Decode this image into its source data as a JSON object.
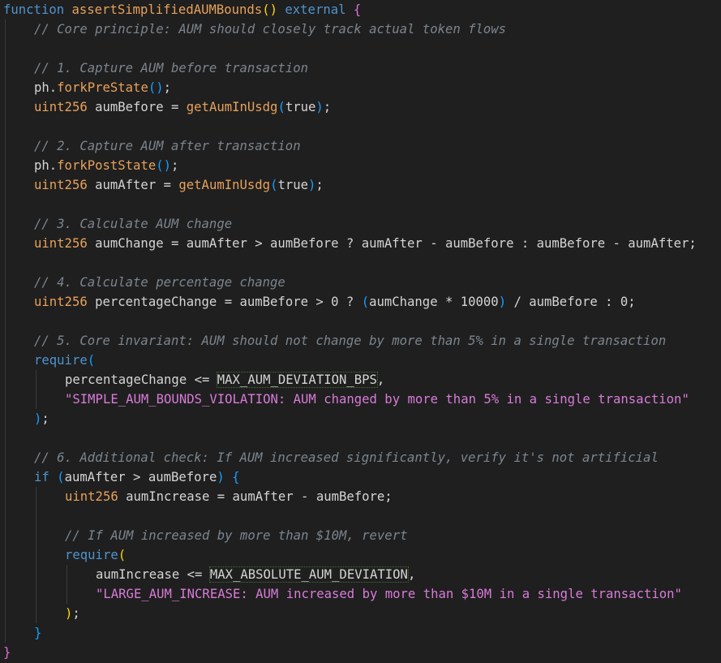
{
  "lines": [
    {
      "indent": 0,
      "tokens": [
        [
          "kw",
          "function"
        ],
        [
          "id",
          " "
        ],
        [
          "fn",
          "assertSimplifiedAUMBounds"
        ],
        [
          "yb",
          "()"
        ],
        [
          "id",
          " "
        ],
        [
          "kw",
          "external"
        ],
        [
          "id",
          " "
        ],
        [
          "pb",
          "{"
        ]
      ]
    },
    {
      "indent": 1,
      "tokens": [
        [
          "cm",
          "// Core principle: AUM should closely track actual token flows"
        ]
      ]
    },
    {
      "indent": 1,
      "tokens": []
    },
    {
      "indent": 1,
      "tokens": [
        [
          "cm",
          "// 1. Capture AUM before transaction"
        ]
      ]
    },
    {
      "indent": 1,
      "tokens": [
        [
          "id",
          "ph."
        ],
        [
          "fn",
          "forkPreState"
        ],
        [
          "bb",
          "()"
        ],
        [
          "id",
          ";"
        ]
      ]
    },
    {
      "indent": 1,
      "tokens": [
        [
          "type",
          "uint256"
        ],
        [
          "id",
          " aumBefore = "
        ],
        [
          "fn",
          "getAumInUsdg"
        ],
        [
          "bb",
          "("
        ],
        [
          "id",
          "true"
        ],
        [
          "bb",
          ")"
        ],
        [
          "id",
          ";"
        ]
      ]
    },
    {
      "indent": 1,
      "tokens": []
    },
    {
      "indent": 1,
      "tokens": [
        [
          "cm",
          "// 2. Capture AUM after transaction"
        ]
      ]
    },
    {
      "indent": 1,
      "tokens": [
        [
          "id",
          "ph."
        ],
        [
          "fn",
          "forkPostState"
        ],
        [
          "bb",
          "()"
        ],
        [
          "id",
          ";"
        ]
      ]
    },
    {
      "indent": 1,
      "tokens": [
        [
          "type",
          "uint256"
        ],
        [
          "id",
          " aumAfter = "
        ],
        [
          "fn",
          "getAumInUsdg"
        ],
        [
          "bb",
          "("
        ],
        [
          "id",
          "true"
        ],
        [
          "bb",
          ")"
        ],
        [
          "id",
          ";"
        ]
      ]
    },
    {
      "indent": 1,
      "tokens": []
    },
    {
      "indent": 1,
      "tokens": [
        [
          "cm",
          "// 3. Calculate AUM change"
        ]
      ]
    },
    {
      "indent": 1,
      "tokens": [
        [
          "type",
          "uint256"
        ],
        [
          "id",
          " aumChange = aumAfter > aumBefore ? aumAfter - aumBefore : aumBefore - aumAfter;"
        ]
      ]
    },
    {
      "indent": 1,
      "tokens": []
    },
    {
      "indent": 1,
      "tokens": [
        [
          "cm",
          "// 4. Calculate percentage change"
        ]
      ]
    },
    {
      "indent": 1,
      "tokens": [
        [
          "type",
          "uint256"
        ],
        [
          "id",
          " percentageChange = aumBefore > 0 ? "
        ],
        [
          "bb",
          "("
        ],
        [
          "id",
          "aumChange * 10000"
        ],
        [
          "bb",
          ")"
        ],
        [
          "id",
          " / aumBefore : 0;"
        ]
      ]
    },
    {
      "indent": 1,
      "tokens": []
    },
    {
      "indent": 1,
      "tokens": [
        [
          "cm",
          "// 5. Core invariant: AUM should not change by more than 5% in a single transaction"
        ]
      ]
    },
    {
      "indent": 1,
      "tokens": [
        [
          "kw",
          "require"
        ],
        [
          "bb",
          "("
        ]
      ]
    },
    {
      "indent": 2,
      "tokens": [
        [
          "id",
          "percentageChange <= "
        ],
        [
          "constbox",
          "MAX_AUM_DEVIATION_BPS"
        ],
        [
          "id",
          ","
        ]
      ]
    },
    {
      "indent": 2,
      "tokens": [
        [
          "str",
          "\"SIMPLE_AUM_BOUNDS_VIOLATION: AUM changed by more than 5% in a single transaction\""
        ]
      ]
    },
    {
      "indent": 1,
      "tokens": [
        [
          "bb",
          ")"
        ],
        [
          "id",
          ";"
        ]
      ]
    },
    {
      "indent": 1,
      "tokens": []
    },
    {
      "indent": 1,
      "tokens": [
        [
          "cm",
          "// 6. Additional check: If AUM increased significantly, verify it's not artificial"
        ]
      ]
    },
    {
      "indent": 1,
      "tokens": [
        [
          "kw",
          "if"
        ],
        [
          "id",
          " "
        ],
        [
          "bb",
          "("
        ],
        [
          "id",
          "aumAfter > aumBefore"
        ],
        [
          "bb",
          ")"
        ],
        [
          "id",
          " "
        ],
        [
          "bb",
          "{"
        ]
      ]
    },
    {
      "indent": 2,
      "tokens": [
        [
          "type",
          "uint256"
        ],
        [
          "id",
          " aumIncrease = aumAfter - aumBefore;"
        ]
      ]
    },
    {
      "indent": 2,
      "tokens": []
    },
    {
      "indent": 2,
      "tokens": [
        [
          "cm",
          "// If AUM increased by more than $10M, revert"
        ]
      ]
    },
    {
      "indent": 2,
      "tokens": [
        [
          "kw",
          "require"
        ],
        [
          "yb",
          "("
        ]
      ]
    },
    {
      "indent": 3,
      "tokens": [
        [
          "id",
          "aumIncrease <= "
        ],
        [
          "constbox",
          "MAX_ABSOLUTE_AUM_DEVIATION"
        ],
        [
          "id",
          ","
        ]
      ]
    },
    {
      "indent": 3,
      "tokens": [
        [
          "str",
          "\"LARGE_AUM_INCREASE: AUM increased by more than $10M in a single transaction\""
        ]
      ]
    },
    {
      "indent": 2,
      "tokens": [
        [
          "yb",
          ")"
        ],
        [
          "id",
          ";"
        ]
      ]
    },
    {
      "indent": 1,
      "tokens": [
        [
          "bb",
          "}"
        ]
      ]
    },
    {
      "indent": 0,
      "tokens": [
        [
          "pb",
          "}"
        ]
      ]
    }
  ],
  "colors": {
    "background": "#1f1f1f",
    "keyword": "#4e94ce",
    "function": "#e7a15a",
    "string": "#d87bd8",
    "comment": "#7c858e",
    "text": "#d4d4d4",
    "bracket_blue": "#179fff",
    "bracket_yellow": "#ffd700",
    "bracket_pink": "#da70d6"
  }
}
